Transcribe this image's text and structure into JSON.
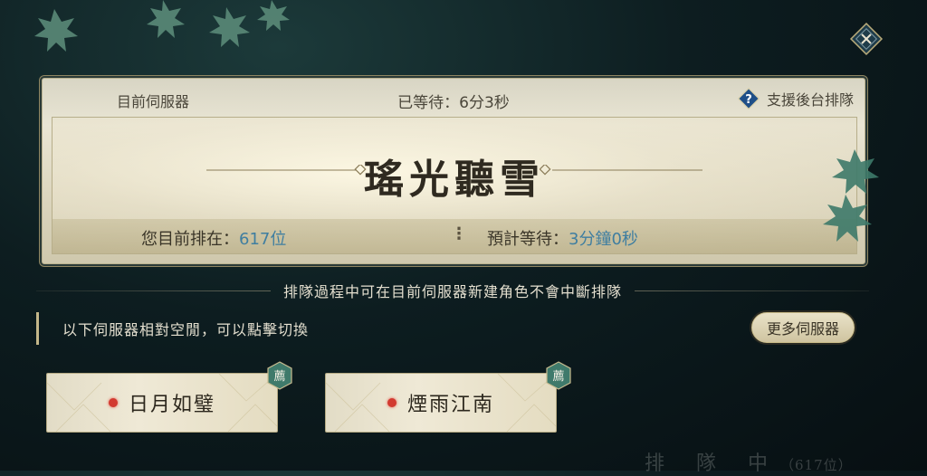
{
  "header": {
    "current_server_label": "目前伺服器",
    "waited_text": "已等待：6分3秒",
    "support_label": "支援後台排隊"
  },
  "server": {
    "name": "瑤光聽雪"
  },
  "queue": {
    "rank_label": "您目前排在：",
    "rank_value": "617位",
    "separator": "⋮",
    "estimate_label": "預計等待：",
    "estimate_value": "3分鐘0秒"
  },
  "notice": "排隊過程中可在目前伺服器新建角色不會中斷排隊",
  "hint": "以下伺服器相對空閒，可以點擊切換",
  "more_servers_label": "更多伺服器",
  "alt_servers": [
    {
      "name": "日月如璧",
      "badge": "薦",
      "status_color": "#d23a30"
    },
    {
      "name": "煙雨江南",
      "badge": "薦",
      "status_color": "#d23a30"
    }
  ],
  "footer": {
    "status": "排 隊 中",
    "count": "（617位）"
  },
  "icons": {
    "close": "close-icon",
    "help": "help-icon",
    "recommend": "recommend-badge-icon"
  }
}
